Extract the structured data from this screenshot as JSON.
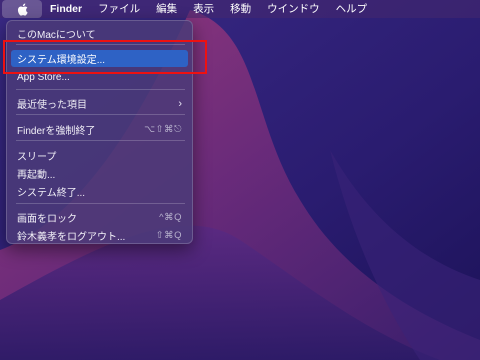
{
  "menubar": {
    "apple_icon": "apple-logo-icon",
    "app_name": "Finder",
    "items": [
      "ファイル",
      "編集",
      "表示",
      "移動",
      "ウインドウ",
      "ヘルプ"
    ]
  },
  "apple_menu": {
    "items": [
      {
        "label": "このMacについて",
        "shortcut": ""
      },
      {
        "label": "システム環境設定...",
        "shortcut": "",
        "selected": true
      },
      {
        "label": "App Store...",
        "shortcut": ""
      },
      {
        "label": "最近使った項目",
        "shortcut": "",
        "submenu_icon": "chevron-right-icon"
      },
      {
        "label": "Finderを強制終了",
        "shortcut": "⌥⇧⌘⎋"
      },
      {
        "label": "スリープ",
        "shortcut": ""
      },
      {
        "label": "再起動...",
        "shortcut": ""
      },
      {
        "label": "システム終了...",
        "shortcut": ""
      },
      {
        "label": "画面をロック",
        "shortcut": "^⌘Q"
      },
      {
        "label": "鈴木義孝をログアウト...",
        "shortcut": "⇧⌘Q"
      }
    ]
  },
  "colors": {
    "selection": "#2e62c5",
    "annotation": "#ee1111",
    "wallpaper_dark": "#24176a",
    "wallpaper_accent": "#c0447f"
  }
}
